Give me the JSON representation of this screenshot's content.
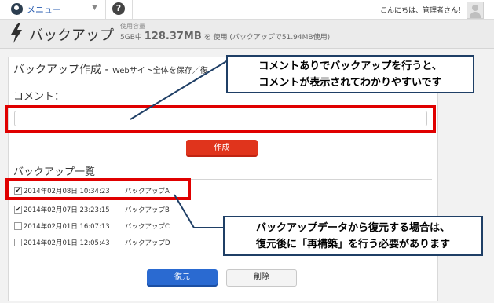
{
  "topbar": {
    "menu_label": "メニュー",
    "menu_caret": "▼",
    "help_glyph": "?",
    "greeting": "こんにちは、管理者さん！"
  },
  "header": {
    "title": "バックアップ",
    "usage_label": "使用容量",
    "usage_prefix": "5GB中",
    "usage_value": "128.37MB",
    "usage_suffix": "を 使用 (バックアップで51.94MB使用)"
  },
  "create_section": {
    "title": "バックアップ作成 -",
    "subtitle": "Webサイト全体を保存／復",
    "comment_label": "コメント：",
    "comment_value": "",
    "create_label": "作成"
  },
  "list_section": {
    "title": "バックアップ一覧",
    "rows": [
      {
        "checked": true,
        "date": "2014年02月08日 10:34:23",
        "name": "バックアップA"
      },
      {
        "checked": true,
        "date": "2014年02月07日 23:23:15",
        "name": "バックアップB"
      },
      {
        "checked": false,
        "date": "2014年02月01日 16:07:13",
        "name": "バックアップC"
      },
      {
        "checked": false,
        "date": "2014年02月01日 12:05:43",
        "name": "バックアップD"
      }
    ],
    "restore_label": "復元",
    "delete_label": "削除"
  },
  "callouts": {
    "comment_line1": "コメントありでバックアップを行うと、",
    "comment_line2": "コメントが表示されてわかりやすいです",
    "restore_line1": "バックアップデータから復元する場合は、",
    "restore_line2": "復元後に「再構築」を行う必要があります"
  },
  "colors": {
    "highlight": "#e00000",
    "callout_border": "#1f3f66",
    "create_button": "#e0341c",
    "restore_button": "#2a6ad1",
    "menu_link": "#2a5db0"
  }
}
